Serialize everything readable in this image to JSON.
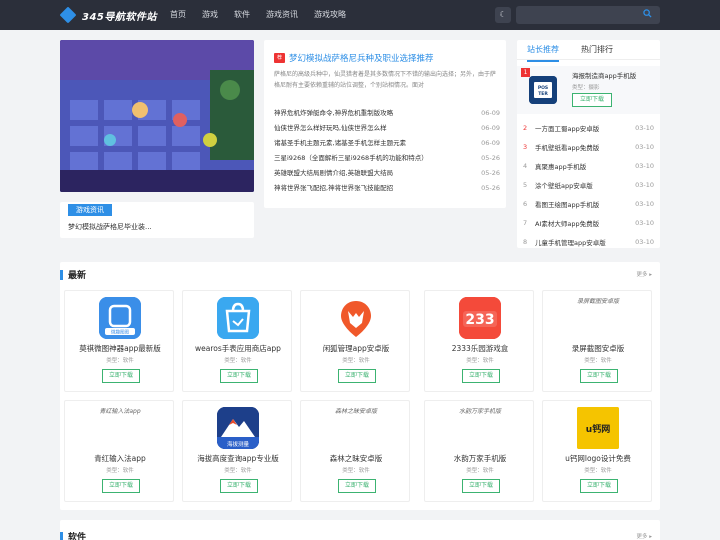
{
  "header": {
    "logo_text": "345导航软件站",
    "nav": [
      "首页",
      "游戏",
      "软件",
      "游戏资讯",
      "游戏攻略"
    ],
    "search_placeholder": ""
  },
  "hero": {
    "badge": "游戏资讯",
    "caption": "梦幻模拟战萨格尼毕业装..."
  },
  "article": {
    "tag": "荐",
    "title": "梦幻模拟战萨格尼兵种及职业选择推荐",
    "desc": "萨格尼的高级兵种中，仙灵猎者着是其多数情况下不错的输出向选择；另外，由于萨格尼耐有主要依赖重辅的站位调整，个别站相情况。面对",
    "news": [
      {
        "title": "神界危机炸弹艇命令,神界危机重制版攻略",
        "date": "06-09"
      },
      {
        "title": "仙侠世界怎么样好玩吗,仙侠世界怎么样",
        "date": "06-09"
      },
      {
        "title": "诸基圣手机主题元素,诸基圣手机怎样主题元素",
        "date": "06-09"
      },
      {
        "title": "三星i9268（全面解析三星i9268手机的功能和特点）",
        "date": "05-26"
      },
      {
        "title": "英雄联盟大结局剧情介绍,英雄联盟大结局",
        "date": "05-26"
      },
      {
        "title": "神将世界张飞配招,神将世界张飞技能配招",
        "date": "05-26"
      }
    ]
  },
  "side": {
    "tab_active": "站长推荐",
    "tab_other": "热门排行",
    "featured": {
      "num": "1",
      "name": "海报制造商app手机版",
      "meta": "类型：摄影",
      "btn": "立即下载",
      "icon_text": "POS TER"
    },
    "ranks": [
      {
        "num": "2",
        "name": "一方面工蜀app安卓版",
        "date": "03-10"
      },
      {
        "num": "3",
        "name": "手机壁纸看app免费版",
        "date": "03-10"
      },
      {
        "num": "4",
        "name": "真聚惠app手机版",
        "date": "03-10"
      },
      {
        "num": "5",
        "name": "涂个壁纸app安卓版",
        "date": "03-10"
      },
      {
        "num": "6",
        "name": "看图王绘图app手机版",
        "date": "03-10"
      },
      {
        "num": "7",
        "name": "AI素材大师app免费版",
        "date": "03-10"
      },
      {
        "num": "8",
        "name": "儿童手机管理app安卓版",
        "date": "03-10"
      }
    ]
  },
  "latest": {
    "title": "最新",
    "more": "更多",
    "apps": [
      {
        "name": "莫祺微图神器app最新版",
        "type": "类型：软件",
        "btn": "立即下载",
        "icon_text": "微趣图图"
      },
      {
        "name": "wearos手表应用商店app",
        "type": "类型：软件",
        "btn": "立即下载",
        "icon_text": ""
      },
      {
        "name": "闲狐管理app安卓版",
        "type": "类型：软件",
        "btn": "立即下载",
        "icon_text": ""
      },
      {
        "name": "2333乐园游戏盒",
        "type": "类型：软件",
        "btn": "立即下载",
        "icon_text": "233"
      },
      {
        "name": "录屏截图安卓版",
        "type": "类型：软件",
        "btn": "立即下载",
        "alt": "录屏截图安卓版"
      },
      {
        "name": "青红输入法app",
        "type": "类型：软件",
        "btn": "立即下载",
        "alt": "青红输入法app"
      },
      {
        "name": "海拔高度查询app专业版",
        "type": "类型：软件",
        "btn": "立即下载",
        "icon_text": "海拔测量"
      },
      {
        "name": "森林之昧安卓版",
        "type": "类型：软件",
        "btn": "立即下载",
        "alt": "森林之昧安卓版"
      },
      {
        "name": "水韵万家手机版",
        "type": "类型：软件",
        "btn": "立即下载",
        "alt": "水韵万家手机版"
      },
      {
        "name": "u钙网logo设计免费",
        "type": "类型：软件",
        "btn": "立即下载",
        "icon_text": "u钙网"
      }
    ]
  },
  "software": {
    "title": "软件",
    "more": "更多"
  }
}
